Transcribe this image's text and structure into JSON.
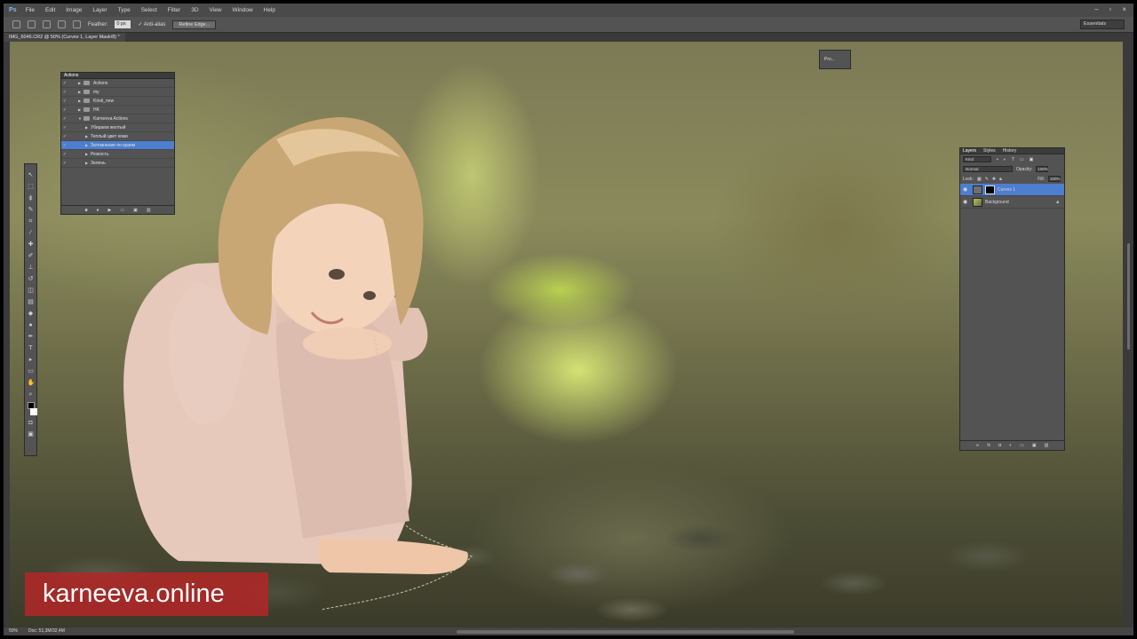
{
  "menubar": {
    "app_logo": "Ps",
    "items": [
      "File",
      "Edit",
      "Image",
      "Layer",
      "Type",
      "Select",
      "Filter",
      "3D",
      "View",
      "Window",
      "Help"
    ]
  },
  "options": {
    "feather_label": "Feather:",
    "feather_value": "0 px",
    "anti_alias": "Anti-alias",
    "refine_edge": "Refine Edge...",
    "workspace": "Essentials"
  },
  "document": {
    "tab_title": "IMG_6046.CR2 @ 50% (Curves 1, Layer Mask/8) *",
    "zoom": "50%",
    "doc_size": "Doc: 51,3M/32,4M"
  },
  "actions_panel": {
    "title": "Actions",
    "rows": [
      {
        "label": "Actions",
        "type": "set",
        "selected": false
      },
      {
        "label": "my",
        "type": "set",
        "selected": false
      },
      {
        "label": "Kristi_new",
        "type": "set",
        "selected": false
      },
      {
        "label": "HK",
        "type": "set",
        "selected": false
      },
      {
        "label": "Karneeva Actions",
        "type": "set-open",
        "selected": false
      },
      {
        "label": "Убираем желтый",
        "type": "action",
        "selected": false
      },
      {
        "label": "Теплый цвет кожи",
        "type": "action",
        "selected": false
      },
      {
        "label": "Затемнение по краям",
        "type": "action",
        "selected": true
      },
      {
        "label": "Резкость",
        "type": "action",
        "selected": false
      },
      {
        "label": "Зелень",
        "type": "action",
        "selected": false
      }
    ]
  },
  "mini_panel": {
    "label": "Pro..."
  },
  "layers_panel": {
    "tabs": [
      "Layers",
      "Styles",
      "History"
    ],
    "filter": "Kind",
    "blend_mode": "Normal",
    "opacity_label": "Opacity:",
    "opacity": "100%",
    "lock_label": "Lock:",
    "fill_label": "Fill:",
    "fill": "100%",
    "layers": [
      {
        "name": "Curves 1",
        "kind": "adjustment",
        "selected": true
      },
      {
        "name": "Background",
        "kind": "photo",
        "selected": false
      }
    ]
  },
  "watermark": {
    "text": "karneeva.online"
  },
  "colors": {
    "accent": "#4d7ecf",
    "watermark_bg": "#af2828",
    "panel": "#535353"
  }
}
